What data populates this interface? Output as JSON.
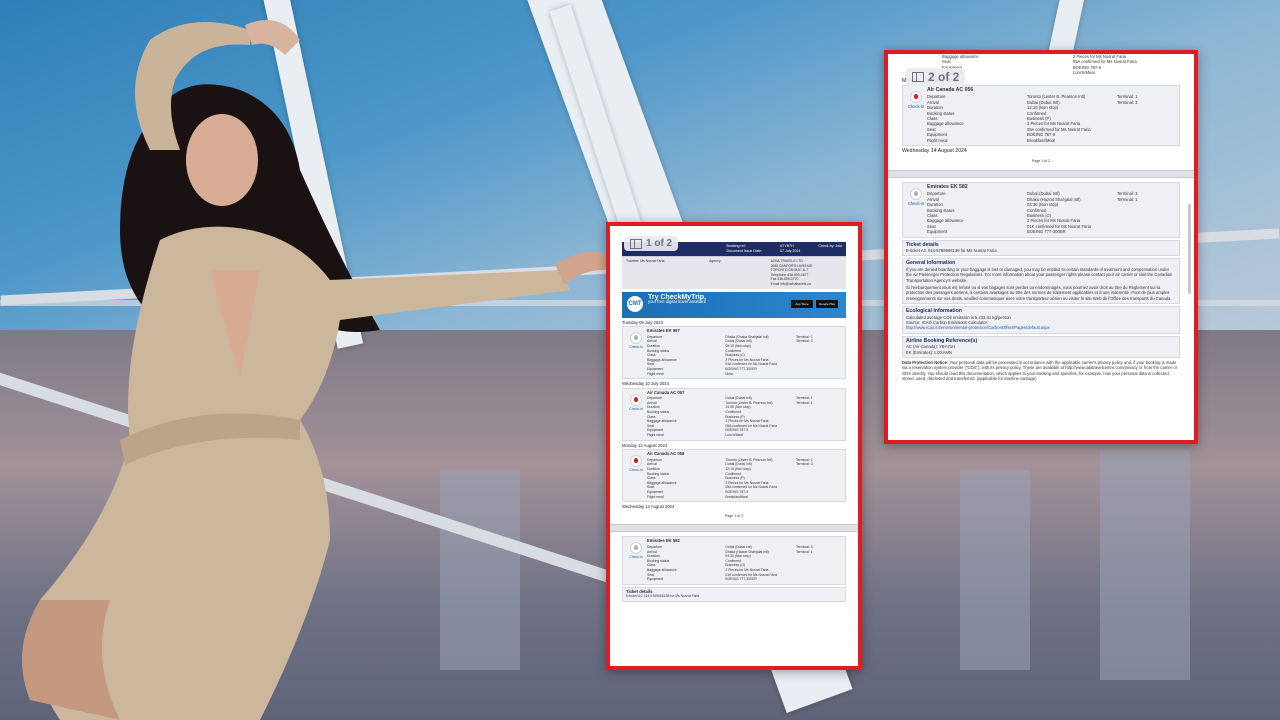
{
  "panels": {
    "left": {
      "page_indicator": "1 of 2",
      "header": {
        "booking_ref_label": "Booking ref:",
        "booking_ref": "ATYB7H",
        "issue_label": "Document Issue Date:",
        "issue_date": "07 July 2024",
        "checkin_label": "Check by:",
        "checkin_value": "Jaia"
      },
      "traveler_label": "Traveler:",
      "traveler": "Ms Nusrat Faria",
      "agency_label": "Agency:",
      "agency": "AZHA TRAVELS LTD",
      "agency_address": "2658 DANFORTH AVENUE",
      "agency_city": "TORONTO ON M4C 1L7",
      "telephone_label": "Telephone",
      "telephone": "416-699-0677",
      "fax_label": "Fax",
      "fax": "416-699-0770",
      "email_label": "Email",
      "email": "info@azhatravels.ca",
      "banner": {
        "logo": "CMT",
        "title": "Try CheckMyTrip,",
        "subtitle": "your free digital travel assistant",
        "store1": "App Store",
        "store2": "Google Play"
      },
      "segments": [
        {
          "date": "Tuesday 09 July 2024",
          "flight": "Emirates EK 997",
          "check_in": "Check-in",
          "rows": [
            [
              "Departure",
              "09 July 19:10",
              "Dhaka (Dhaka Shahjalal Intl)",
              "Terminal: 1"
            ],
            [
              "Arrival",
              "09 July 22:25",
              "Dubai (Dubai Intl)",
              "Terminal: 3"
            ],
            [
              "Duration",
              "05:15 (Non stop)",
              "",
              ""
            ],
            [
              "Booking status",
              "Confirmed",
              "",
              ""
            ],
            [
              "Class",
              "Business (C)",
              "",
              ""
            ],
            [
              "Baggage allowance",
              "2 Pieces for Ms Nusrat Faria",
              "",
              ""
            ],
            [
              "Seat",
              "04A confirmed for Ms Nusrat Faria",
              "",
              ""
            ],
            [
              "Equipment",
              "BOEING 777-300ER",
              "",
              ""
            ],
            [
              "Flight meal",
              "Meal",
              "",
              ""
            ]
          ]
        },
        {
          "date": "Wednesday 10 July 2024",
          "flight": "Air Canada AC 057",
          "check_in": "Check-in",
          "rows": [
            [
              "Departure",
              "10 July 09:40",
              "Dubai (Dubai Intl)",
              "Terminal: 1"
            ],
            [
              "Arrival",
              "10 July 15:35",
              "Toronto (Lester B. Pearson Intl)",
              "Terminal: 1"
            ],
            [
              "Duration",
              "14:55 (Non stop)",
              "",
              ""
            ],
            [
              "Booking status",
              "Confirmed",
              "",
              ""
            ],
            [
              "Class",
              "Business (P)",
              "",
              ""
            ],
            [
              "Baggage allowance",
              "2 Pieces for Ms Nusrat Faria",
              "",
              ""
            ],
            [
              "Seat",
              "05A confirmed for Ms Nusrat Faria",
              "",
              ""
            ],
            [
              "Equipment",
              "BOEING 787-9",
              "",
              ""
            ],
            [
              "Flight meal",
              "Lunch/Meal",
              "",
              ""
            ]
          ]
        },
        {
          "date": "Monday 12 August 2024",
          "flight": "Air Canada AC 056",
          "check_in": "Check-in",
          "rows": [
            [
              "Departure",
              "12 August 22:35",
              "Toronto (Lester B. Pearson Intl)",
              "Terminal: 1"
            ],
            [
              "Arrival",
              "13 August 18:45",
              "Dubai (Dubai Intl)",
              "Terminal: 3"
            ],
            [
              "Duration",
              "12:10 (Non stop)",
              "",
              ""
            ],
            [
              "Booking status",
              "Confirmed",
              "",
              ""
            ],
            [
              "Class",
              "Business (P)",
              "",
              ""
            ],
            [
              "Baggage allowance",
              "2 Pieces for Ms Nusrat Faria",
              "",
              ""
            ],
            [
              "Seat",
              "05A confirmed for Ms Nusrat Faria",
              "",
              ""
            ],
            [
              "Equipment",
              "BOEING 787-9",
              "",
              ""
            ],
            [
              "Flight meal",
              "Breakfast/Meal",
              "",
              ""
            ]
          ]
        }
      ],
      "after_date": "Wednesday 14 August 2024",
      "footer": "Page 1 of 2",
      "next_flight": "Emirates EK 582",
      "next_check_in": "Check-in",
      "next_rows": [
        [
          "Departure",
          "14 August 09:35",
          "Dubai (Dubai Intl)",
          "Terminal: 3"
        ],
        [
          "Arrival",
          "14 August 16:05",
          "Dhaka (Hazrat Shahjalal Intl)",
          "Terminal: 1"
        ],
        [
          "Duration",
          "04:30 (Non stop)",
          "",
          ""
        ],
        [
          "Booking status",
          "Confirmed",
          "",
          ""
        ],
        [
          "Class",
          "Business (O)",
          "",
          ""
        ],
        [
          "Baggage allowance",
          "2 Pieces for Ms Nusrat Faria",
          "",
          ""
        ],
        [
          "Seat",
          "01K confirmed for Ms Nusrat Faria",
          "",
          ""
        ],
        [
          "Equipment",
          "BOEING 777-300ER",
          "",
          ""
        ]
      ],
      "ticket_title": "Ticket details",
      "ticket_line": "E-ticket AC 014-5769608138 for Ms Nusrat Faria"
    },
    "right": {
      "page_indicator": "2 of 2",
      "top_rows": [
        [
          "Baggage allowance",
          "2 Pieces for Ms Nusrat Faria"
        ],
        [
          "Seat",
          "05A confirmed for Ms Nusrat Faria"
        ],
        [
          "Equipment",
          "BOEING 787-9"
        ],
        [
          "Flight meal",
          "Lunch/Meal"
        ]
      ],
      "segment": {
        "date": "Monday 12 August 2024",
        "flight": "Air Canada AC 056",
        "check_in": "Check-in",
        "rows": [
          [
            "Departure",
            "12 August 22:35",
            "Toronto (Lester B. Pearson Intl)",
            "Terminal: 1"
          ],
          [
            "Arrival",
            "13 August 18:45",
            "Dubai (Dubai Intl)",
            "Terminal: 3"
          ],
          [
            "Duration",
            "12:10 (Non stop)",
            "",
            ""
          ],
          [
            "Booking status",
            "Confirmed",
            "",
            ""
          ],
          [
            "Class",
            "Business (P)",
            "",
            ""
          ],
          [
            "Baggage allowance",
            "2 Pieces for Ms Nusrat Faria",
            "",
            ""
          ],
          [
            "Seat",
            "05A confirmed for Ms Nusrat Faria",
            "",
            ""
          ],
          [
            "Equipment",
            "BOEING 787-9",
            "",
            ""
          ],
          [
            "Flight meal",
            "Breakfast/Meal",
            "",
            ""
          ]
        ]
      },
      "after_date": "Wednesday 14 August 2024",
      "footer": "Page 1 of 2",
      "segment2": {
        "flight": "Emirates EK 582",
        "check_in": "Check-in",
        "rows": [
          [
            "Departure",
            "14 August 09:35",
            "Dubai (Dubai Intl)",
            "Terminal: 3"
          ],
          [
            "Arrival",
            "14 August 16:05",
            "Dhaka (Hazrat Shahjalal Intl)",
            "Terminal: 1"
          ],
          [
            "Duration",
            "04:30 (Non stop)",
            "",
            ""
          ],
          [
            "Booking status",
            "Confirmed",
            "",
            ""
          ],
          [
            "Class",
            "Business (O)",
            "",
            ""
          ],
          [
            "Baggage allowance",
            "2 Pieces for Ms Nusrat Faria",
            "",
            ""
          ],
          [
            "Seat",
            "01K confirmed for Ms Nusrat Faria",
            "",
            ""
          ],
          [
            "Equipment",
            "BOEING 777-300ER",
            "",
            ""
          ]
        ]
      },
      "ticket": {
        "title": "Ticket details",
        "line": "E-ticket AC 014-5769608138 for Ms Nusrat Faria"
      },
      "general": {
        "title": "General Information",
        "p1": "If you are denied boarding or your baggage is lost or damaged, you may be entitled to certain standards of treatment and compensation under the Air Passenger Protection Regulations. For more information about your passenger rights please contact your air carrier or visit the Canadian Transportation Agency's website.",
        "p2": "Si l'embarquement vous est refusé ou si vos bagages sont perdus ou endommagés, vous pourriez avoir droit au titre du Règlement sur la protection des passagers aériens, à certains avantages au titre des normes de traitement applicables et à une indemnité. Pour de plus amples renseignements sur vos droits, veuillez communiquer avec votre transporteur aérien ou visiter le site Web de l'Office des transports du Canada."
      },
      "ecological": {
        "title": "Ecological Information",
        "line1": "Calculated average CO2 emission is 5,233.31 kg/person",
        "line2": "Source: ICAO Carbon Emissions Calculator",
        "link": "http://www.icao.int/environmental-protection/CarbonOffset/Pages/default.aspx"
      },
      "airline_ref": {
        "title": "Airline Booking Reference(s)",
        "line1": "AC (Air Canada): YBYZ1H",
        "line2": "EK (Emirates): LOXAMN"
      },
      "data_protection_label": "Data Protection Notice:",
      "data_protection": "Your personal data will be processed in accordance with the applicable carrier's privacy policy and, if your booking is made via a reservation system provider (\"GDS\"), with its privacy policy. These are available at http://www.iatatravelcentre.com/privacy or from the carrier or GDS directly. You should read this documentation, which applies to your booking and specifies, for example, how your personal data is collected, stored, used, disclosed and transferred. (applicable for interline carriage)"
    }
  },
  "colors": {
    "panel_border": "#e01c22",
    "doc_header": "#1f2c66",
    "banner": "#1b6fb5"
  }
}
